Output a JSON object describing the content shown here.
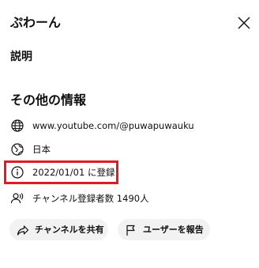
{
  "header": {
    "title": "ぷわーん",
    "close_icon": "close-icon"
  },
  "description": {
    "heading": "説明"
  },
  "info": {
    "heading": "その他の情報",
    "rows": [
      {
        "icon": "globe-icon",
        "text": "www.youtube.com/@puwapuwauku"
      },
      {
        "icon": "globe-location-icon",
        "text": "日本"
      },
      {
        "icon": "info-icon",
        "text": "2022/01/01 に登録",
        "highlighted": true
      },
      {
        "icon": "subscribers-icon",
        "text": "チャンネル登録者数 1490人"
      }
    ]
  },
  "actions": {
    "share_label": "チャンネルを共有",
    "share_icon": "share-icon",
    "report_label": "ユーザーを報告",
    "report_icon": "flag-icon"
  },
  "colors": {
    "highlight": "#e01b24",
    "pill_background": "#f2f2f2",
    "text": "#0f0f0f"
  }
}
